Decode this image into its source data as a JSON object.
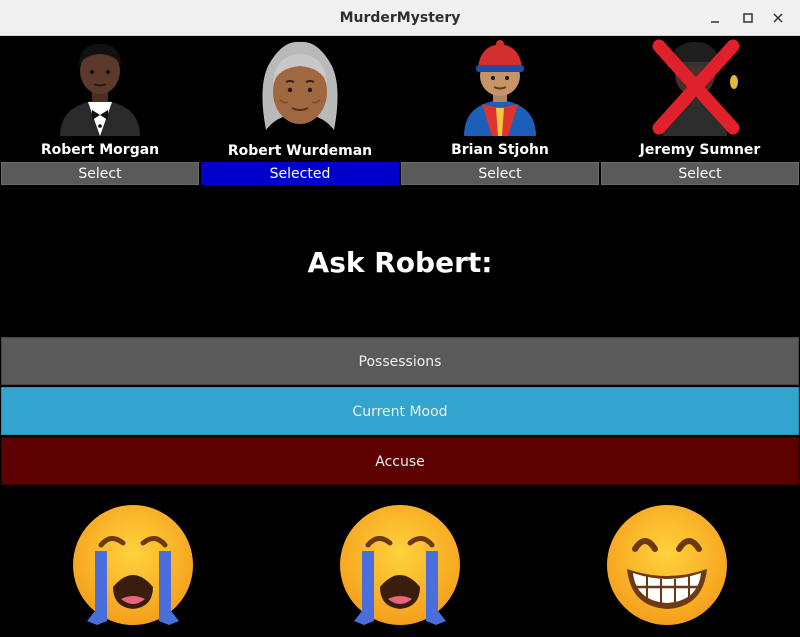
{
  "window": {
    "title": "MurderMystery"
  },
  "characters": [
    {
      "name": "Robert Morgan",
      "button": "Select",
      "selected": false,
      "portrait": "man-in-tuxedo-icon"
    },
    {
      "name": "Robert Wurdeman",
      "button": "Selected",
      "selected": true,
      "portrait": "older-person-icon"
    },
    {
      "name": "Brian Stjohn",
      "button": "Select",
      "selected": false,
      "portrait": "person-with-cap-icon"
    },
    {
      "name": "Jeremy Sumner",
      "button": "Select",
      "selected": false,
      "portrait": "eliminated-suspect-icon"
    }
  ],
  "prompt": "Ask Robert:",
  "actions": [
    {
      "label": "Possessions",
      "color": "#5a5a5a"
    },
    {
      "label": "Current Mood",
      "color": "#32a4cd"
    },
    {
      "label": "Accuse",
      "color": "#5c0000"
    }
  ],
  "moods": [
    "loudly-crying-face-icon",
    "loudly-crying-face-icon",
    "grinning-face-icon"
  ],
  "colors": {
    "selected": "#0000cc",
    "button": "#5a5a5a"
  }
}
